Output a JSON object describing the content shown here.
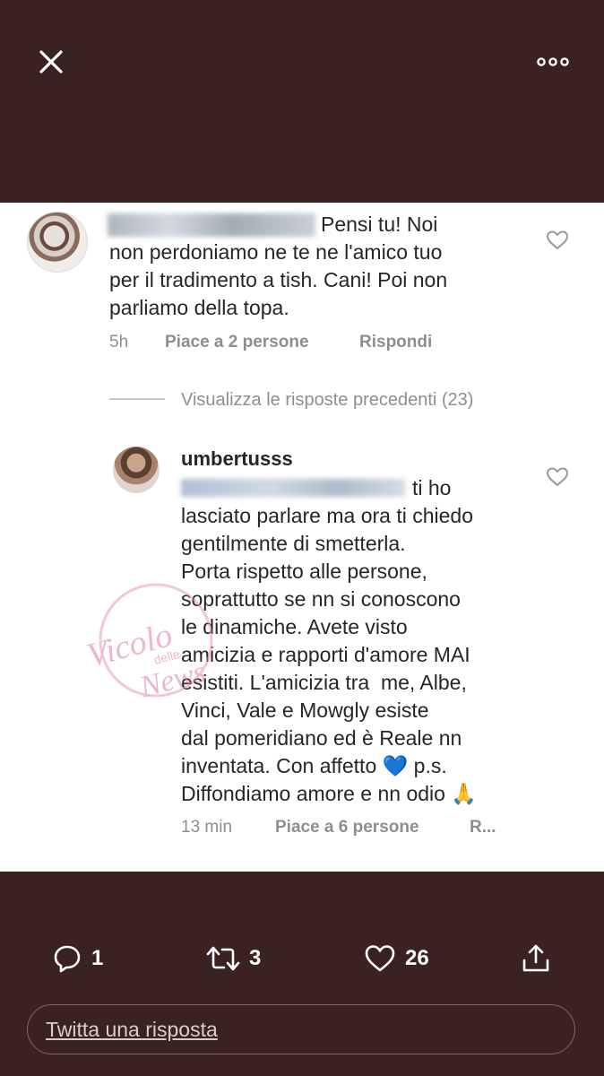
{
  "header": {
    "close_icon": "close-icon",
    "more_icon": "more-icon"
  },
  "comment1": {
    "line1": "Pensi tu! Noi",
    "line2": "non perdoniamo ne te ne l'amico tuo",
    "line3": "per il tradimento a tish. Cani! Poi non",
    "line4": "parliamo della topa.",
    "time": "5h",
    "likes": "Piace a 2 persone",
    "reply": "Rispondi"
  },
  "view_previous": "Visualizza le risposte precedenti (23)",
  "comment2": {
    "username": "umbertusss",
    "line1": "ti ho",
    "line2": "lasciato parlare ma ora ti chiedo",
    "line3": "gentilmente di smetterla.",
    "line4": "Porta rispetto alle persone,",
    "line5": "soprattutto se nn si conoscono",
    "line6": "le dinamiche. Avete visto",
    "line7": "amicizia e rapporti d'amore MAI",
    "line8": "esistiti. L'amicizia tra  me, Albe,",
    "line9": "Vinci, Vale e Mowgly esiste",
    "line10": "dal pomeridiano ed è Reale nn",
    "line11": "inventata. Con affetto 💙 p.s.",
    "line12": "Diffondiamo amore e nn odio 🙏",
    "time": "13 min",
    "likes": "Piace a 6 persone",
    "reply": "R..."
  },
  "watermark": {
    "text1": "Vicolo",
    "text2": "delle",
    "text3": "News"
  },
  "actions": {
    "replies": "1",
    "retweets": "3",
    "likes": "26"
  },
  "reply_box": {
    "placeholder": "Twitta una risposta"
  },
  "colors": {
    "background": "#3a2221",
    "card": "#ffffff",
    "text": "#262626",
    "meta": "#8e8e8e"
  }
}
